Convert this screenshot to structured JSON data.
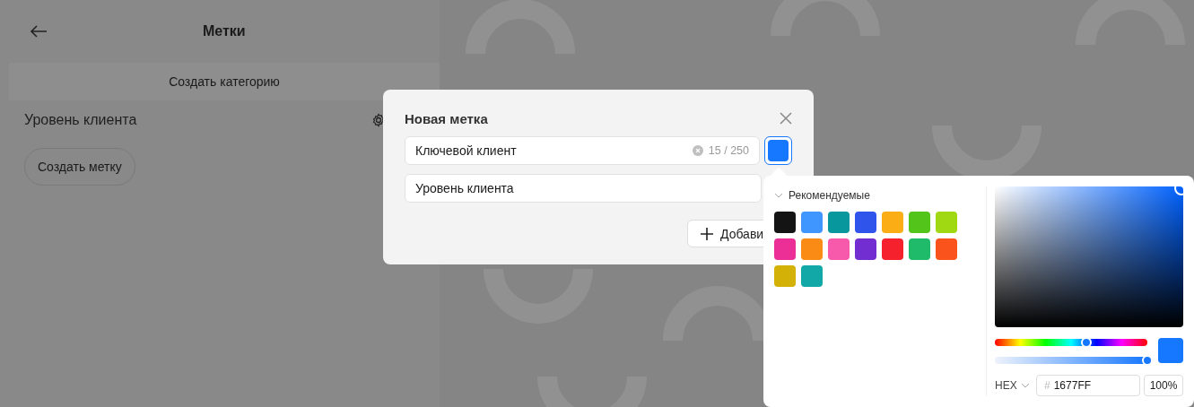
{
  "header": {
    "title": "Метки"
  },
  "create_category_button": "Создать категорию",
  "category": {
    "name": "Уровень клиента",
    "create_tag_button": "Создать метку"
  },
  "dialog": {
    "title": "Новая метка",
    "name_field": {
      "value": "Ключевой клиент",
      "counter": "15 / 250"
    },
    "color": "#1677ff",
    "category_field": {
      "value": "Уровень клиента"
    },
    "add_button": "Добави"
  },
  "color_picker": {
    "section": {
      "title": "Рекомендуемые",
      "expanded": true
    },
    "swatches": [
      {
        "color": "#141414"
      },
      {
        "color": "#4096ff"
      },
      {
        "color": "#08979c"
      },
      {
        "color": "#2f54eb"
      },
      {
        "color": "#faad14"
      },
      {
        "color": "#52c41a"
      },
      {
        "color": "#a0d911"
      },
      {
        "color": "#eb2f96"
      },
      {
        "color": "#fa8c16"
      },
      {
        "color": "#f759ab"
      },
      {
        "color": "#722ed1"
      },
      {
        "color": "#f5222d"
      },
      {
        "color": "#1fbb6a"
      },
      {
        "color": "#fa541c"
      },
      {
        "color": "#d4b106"
      },
      {
        "color": "#13a8a8"
      }
    ],
    "hue": {
      "level": 0.6
    },
    "alpha": {
      "level": 1
    },
    "format": "HEX",
    "hash": "#",
    "hex": "1677FF",
    "opacity": "100%"
  }
}
